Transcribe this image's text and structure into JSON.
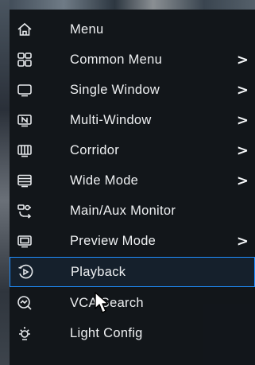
{
  "menu": {
    "items": [
      {
        "label": "Menu",
        "icon": "home-icon",
        "submenu": false
      },
      {
        "label": "Common Menu",
        "icon": "grid-icon",
        "submenu": true
      },
      {
        "label": "Single Window",
        "icon": "single-window-icon",
        "submenu": true
      },
      {
        "label": "Multi-Window",
        "icon": "multi-window-icon",
        "submenu": true
      },
      {
        "label": "Corridor",
        "icon": "corridor-icon",
        "submenu": true
      },
      {
        "label": "Wide Mode",
        "icon": "wide-mode-icon",
        "submenu": true
      },
      {
        "label": "Main/Aux Monitor",
        "icon": "monitor-switch-icon",
        "submenu": false
      },
      {
        "label": "Preview Mode",
        "icon": "preview-mode-icon",
        "submenu": true
      },
      {
        "label": "Playback",
        "icon": "playback-icon",
        "submenu": false,
        "selected": true
      },
      {
        "label": "VCA Search",
        "icon": "vca-search-icon",
        "submenu": false
      },
      {
        "label": "Light Config",
        "icon": "light-config-icon",
        "submenu": false
      }
    ],
    "submenu_arrow": ">"
  },
  "colors": {
    "background": "#12161b",
    "text": "#eef0f2",
    "selection_border": "#1f8fff"
  }
}
